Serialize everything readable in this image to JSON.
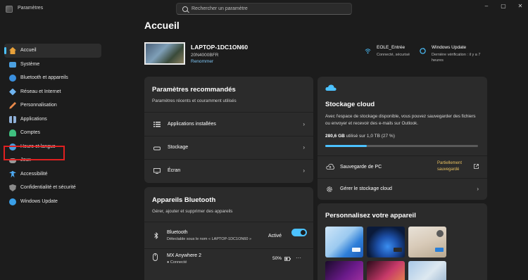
{
  "window": {
    "title": "Paramètres",
    "controls": [
      "‒",
      "▢",
      "✕"
    ]
  },
  "search": {
    "placeholder": "Rechercher un paramètre"
  },
  "sidebar": {
    "items": [
      {
        "label": "Accueil",
        "icon": "home-icon",
        "color": "#e8a13a",
        "active": true
      },
      {
        "label": "Système",
        "icon": "system-icon",
        "color": "#4ca0e0"
      },
      {
        "label": "Bluetooth et appareils",
        "icon": "bluetooth-icon",
        "color": "#3a8fde"
      },
      {
        "label": "Réseau et Internet",
        "icon": "network-icon",
        "color": "#6fb4f0"
      },
      {
        "label": "Personnalisation",
        "icon": "brush-icon",
        "color": "#e8884a"
      },
      {
        "label": "Applications",
        "icon": "apps-icon",
        "color": "#8fb0d8"
      },
      {
        "label": "Comptes",
        "icon": "accounts-icon",
        "color": "#3fbf7f"
      },
      {
        "label": "Heure et langue",
        "icon": "time-language-icon",
        "color": "#4a9fe0"
      },
      {
        "label": "Jeux",
        "icon": "games-icon",
        "color": "#9a9a9a"
      },
      {
        "label": "Accessibilité",
        "icon": "accessibility-icon",
        "color": "#4ca8f0"
      },
      {
        "label": "Confidentialité et sécurité",
        "icon": "shield-icon",
        "color": "#8a8a8a"
      },
      {
        "label": "Windows Update",
        "icon": "update-icon",
        "color": "#3a9fe8"
      }
    ]
  },
  "main": {
    "title": "Accueil",
    "device": {
      "name": "LAPTOP-1DC1ON60",
      "model": "20N4000BFR",
      "rename": "Renommer"
    },
    "status": [
      {
        "title": "EOLE_Entrée",
        "sub": "Connecté, sécurisé",
        "icon": "wifi-icon"
      },
      {
        "title": "Windows Update",
        "sub": "Dernière vérification : il y a 7 heures",
        "icon": "update-icon"
      }
    ],
    "recommended": {
      "title": "Paramètres recommandés",
      "subtitle": "Paramètres récents et couramment utilisés",
      "rows": [
        {
          "label": "Applications installées",
          "icon": "list-icon"
        },
        {
          "label": "Stockage",
          "icon": "storage-icon"
        },
        {
          "label": "Écran",
          "icon": "display-icon"
        }
      ]
    },
    "bluetooth": {
      "title": "Appareils Bluetooth",
      "subtitle": "Gérer, ajouter et supprimer des appareils",
      "bt_label": "Bluetooth",
      "bt_sub": "Détectable sous le nom « LAPTOP-1DC1ON60 »",
      "bt_state": "Activé",
      "device_name": "MX Anywhere 2",
      "device_status": "● Connecté",
      "device_battery": "50%",
      "more": "···"
    },
    "cloud": {
      "title": "Stockage cloud",
      "desc": "Avec l'espace de stockage disponible, vous pouvez sauvegarder des fichiers ou envoyer et recevoir des e-mails sur Outlook.",
      "used_value": "280,6 GB",
      "used_rest": " utilisé sur 1,0 TB (27 %)",
      "used_fraction": 0.27,
      "backup_label": "Sauvegarde de PC",
      "backup_status": "Partiellement sauvegardé",
      "manage_label": "Gérer le stockage cloud",
      "accent": "#4cc2ff",
      "status_color": "#e8c060"
    },
    "personalize": {
      "title": "Personnalisez votre appareil"
    }
  }
}
